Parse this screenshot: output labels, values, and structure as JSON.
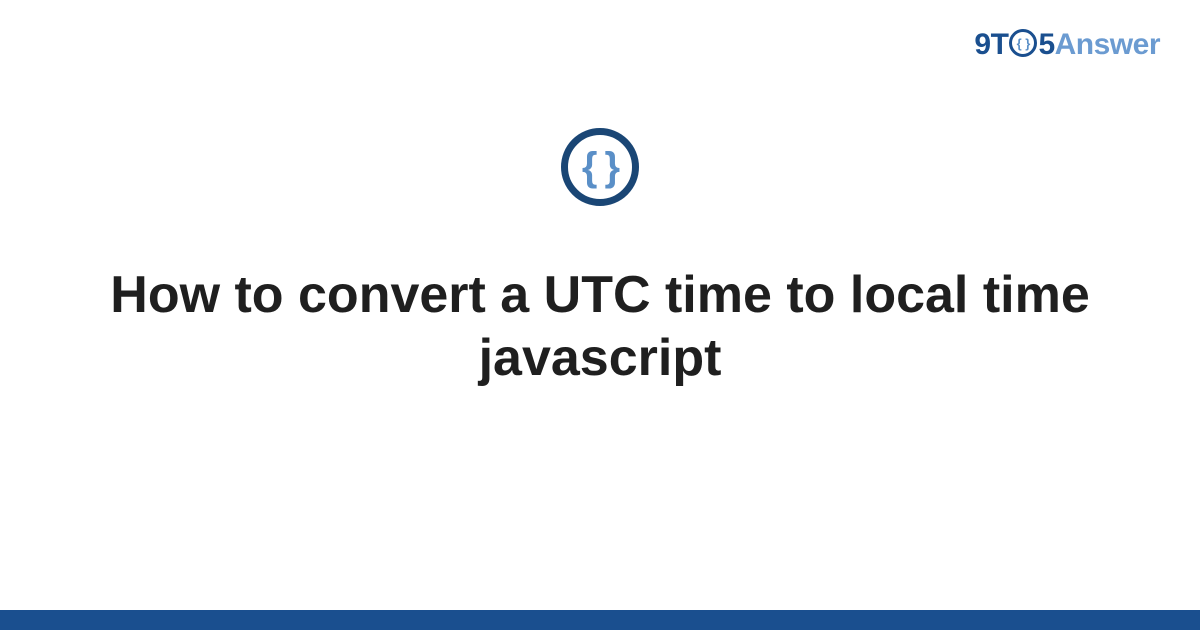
{
  "logo": {
    "p1": "9T",
    "o_inner": "{ }",
    "p2": "5",
    "answer": "Answer"
  },
  "badge": {
    "glyph": "{ }"
  },
  "title": "How to convert a UTC time to local time javascript",
  "colors": {
    "brand_dark": "#1a4f8f",
    "brand_light": "#6b9bd1",
    "badge_ring": "#1a4675",
    "badge_inner": "#5a8fc7",
    "heading": "#1f1f1f"
  }
}
